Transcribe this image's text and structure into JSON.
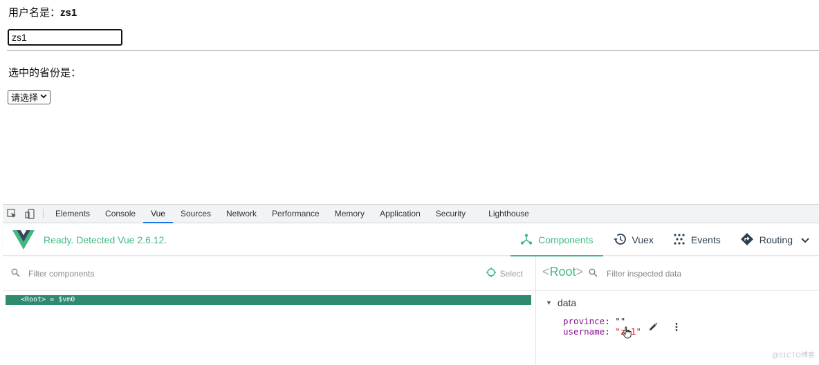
{
  "page": {
    "username_label": "用户名是：",
    "username_value": "zs1",
    "username_input_value": "zs1",
    "province_label": "选中的省份是：",
    "province_select_value": "请选择"
  },
  "devtools": {
    "tabs": [
      "Elements",
      "Console",
      "Vue",
      "Sources",
      "Network",
      "Performance",
      "Memory",
      "Application",
      "Security",
      "Lighthouse"
    ],
    "active_tab": "Vue"
  },
  "vue": {
    "status": "Ready. Detected Vue 2.6.12.",
    "nav": {
      "components": "Components",
      "vuex": "Vuex",
      "events": "Events",
      "routing": "Routing"
    },
    "accent_color": "#42b983",
    "filter_components_placeholder": "Filter components",
    "select_label": "Select",
    "root_row": "<Root> = $vm0",
    "inspector": {
      "root_open": "<",
      "root_name": "Root",
      "root_close": ">",
      "filter_placeholder": "Filter inspected data",
      "section": "data",
      "props": [
        {
          "key": "province",
          "value": "\"\""
        },
        {
          "key": "username",
          "value": "\"zs1\""
        }
      ]
    }
  },
  "watermark": "@51CTO博客"
}
